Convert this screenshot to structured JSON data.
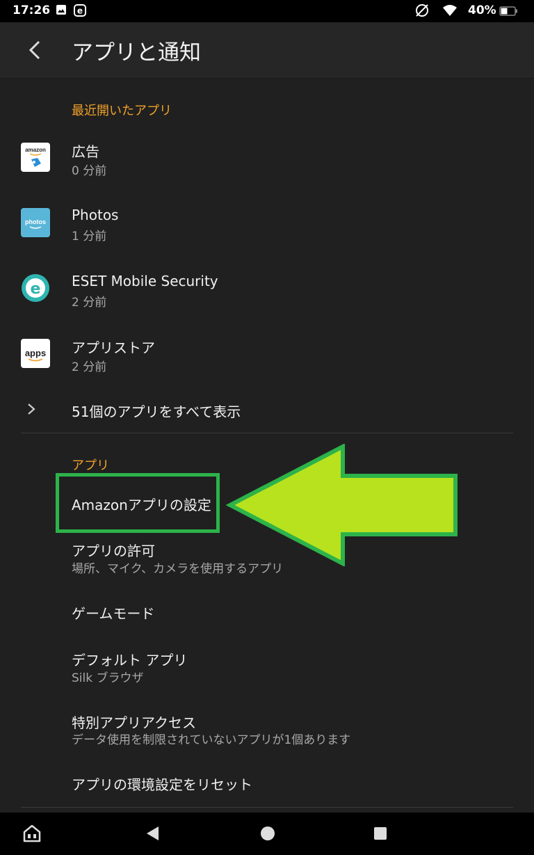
{
  "status_bar": {
    "time": "17:26",
    "battery": "40%",
    "icons": [
      "image-icon",
      "e-badge-icon",
      "no-sim-icon",
      "wifi-icon",
      "battery-icon"
    ]
  },
  "header": {
    "title": "アプリと通知"
  },
  "recent": {
    "section_title": "最近開いたアプリ",
    "apps": [
      {
        "name": "広告",
        "time": "0 分前",
        "icon": "amazon-ads-icon"
      },
      {
        "name": "Photos",
        "time": "1 分前",
        "icon": "photos-icon"
      },
      {
        "name": "ESET Mobile Security",
        "time": "2 分前",
        "icon": "eset-icon"
      },
      {
        "name": "アプリストア",
        "time": "2 分前",
        "icon": "appstore-icon"
      }
    ],
    "show_all": "51個のアプリをすべて表示"
  },
  "apps_section": {
    "section_title": "アプリ",
    "items": [
      {
        "label": "Amazonアプリの設定"
      },
      {
        "label": "アプリの許可",
        "sub": "場所、マイク、カメラを使用するアプリ"
      },
      {
        "label": "ゲームモード"
      },
      {
        "label": "デフォルト アプリ",
        "sub": "Silk ブラウザ"
      },
      {
        "label": "特別アプリアクセス",
        "sub": "データ使用を制限されていないアプリが1個あります"
      },
      {
        "label": "アプリの環境設定をリセット"
      }
    ]
  },
  "app_icons_text": {
    "amazon": "amazon",
    "photos": "photos",
    "apps": "apps"
  },
  "colors": {
    "accent": "#f0a12a",
    "highlight": "#2db34a",
    "arrow_fill": "#b8e21e"
  }
}
